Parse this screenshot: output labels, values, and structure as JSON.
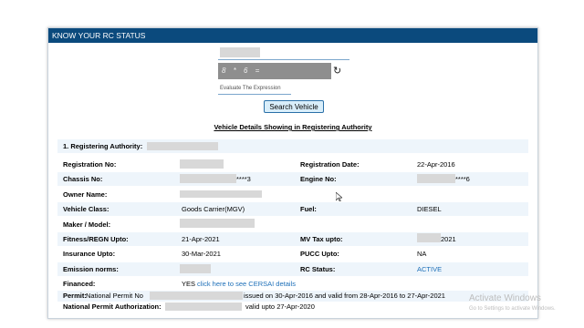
{
  "panel_title": "KNOW YOUR RC STATUS",
  "captcha": {
    "expression": "8 * 6 =",
    "hint": "Evaluate The Expression"
  },
  "search_button": "Search Vehicle",
  "section_heading": "Vehicle Details Showing in Registering Authority",
  "registering_authority_label": "1. Registering Authority:",
  "fields": {
    "registration_no": {
      "label": "Registration No:"
    },
    "registration_date": {
      "label": "Registration Date:",
      "value": "22-Apr-2016"
    },
    "chassis_no": {
      "label": "Chassis No:",
      "value": "****3"
    },
    "engine_no": {
      "label": "Engine No:",
      "value": "****6"
    },
    "owner_name": {
      "label": "Owner Name:"
    },
    "vehicle_class": {
      "label": "Vehicle Class:",
      "value": "Goods Carrier(MGV)"
    },
    "fuel": {
      "label": "Fuel:",
      "value": "DIESEL"
    },
    "maker_model": {
      "label": "Maker / Model:"
    },
    "fitness_upto": {
      "label": "Fitness/REGN Upto:",
      "value": "21-Apr-2021"
    },
    "mv_tax_upto": {
      "label": "MV Tax upto:",
      "value": "2021"
    },
    "insurance_upto": {
      "label": "Insurance Upto:",
      "value": "30-Mar-2021"
    },
    "pucc_upto": {
      "label": "PUCC Upto:",
      "value": "NA"
    },
    "emission_norms": {
      "label": "Emission norms:"
    },
    "rc_status": {
      "label": "RC Status:",
      "value": "ACTIVE"
    },
    "financed": {
      "label": "Financed:",
      "value": "YES",
      "link": "click here to see CERSAI details"
    }
  },
  "permit": {
    "label": "Permit:",
    "prefix": "National Permit No",
    "suffix": "issued on 30-Apr-2016 and valid from 28-Apr-2016 to 27-Apr-2021"
  },
  "national_permit": {
    "label": "National Permit Authorization:",
    "suffix": "valid upto 27-Apr-2020"
  },
  "watermark": {
    "line1": "Activate Windows",
    "line2": "Go to Settings to activate Windows."
  }
}
